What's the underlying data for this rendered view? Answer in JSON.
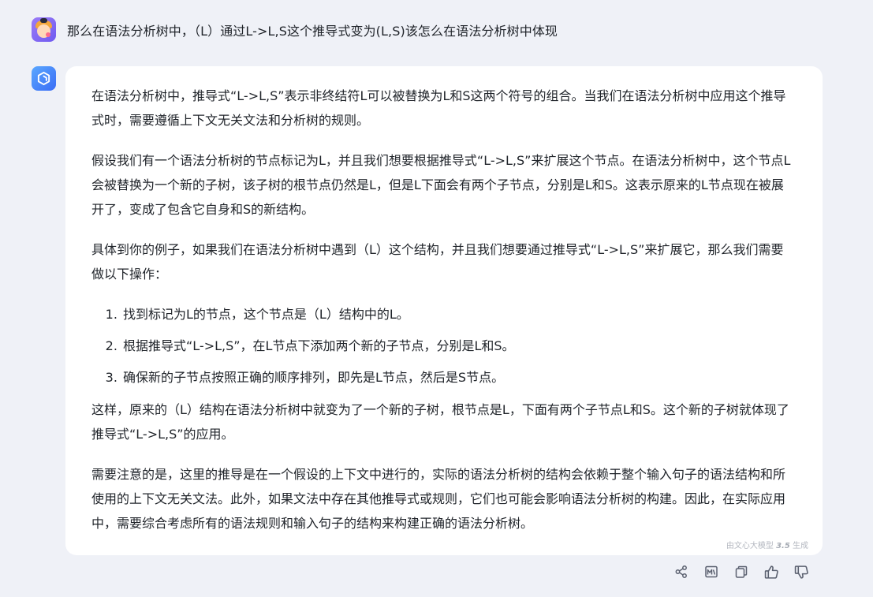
{
  "user": {
    "avatar_icon": "user-avatar-icon",
    "question": "那么在语法分析树中，（L）通过L->L,S这个推导式变为(L,S)该怎么在语法分析树中体现"
  },
  "bot": {
    "avatar_icon": "bot-avatar-icon",
    "paragraphs": [
      "在语法分析树中，推导式“L->L,S”表示非终结符L可以被替换为L和S这两个符号的组合。当我们在语法分析树中应用这个推导式时，需要遵循上下文无关文法和分析树的规则。",
      "假设我们有一个语法分析树的节点标记为L，并且我们想要根据推导式“L->L,S”来扩展这个节点。在语法分析树中，这个节点L会被替换为一个新的子树，该子树的根节点仍然是L，但是L下面会有两个子节点，分别是L和S。这表示原来的L节点现在被展开了，变成了包含它自身和S的新结构。",
      "具体到你的例子，如果我们在语法分析树中遇到（L）这个结构，并且我们想要通过推导式“L->L,S”来扩展它，那么我们需要做以下操作："
    ],
    "steps": [
      "找到标记为L的节点，这个节点是（L）结构中的L。",
      "根据推导式“L->L,S”，在L节点下添加两个新的子节点，分别是L和S。",
      "确保新的子节点按照正确的顺序排列，即先是L节点，然后是S节点。"
    ],
    "after": [
      "这样，原来的（L）结构在语法分析树中就变为了一个新的子树，根节点是L，下面有两个子节点L和S。这个新的子树就体现了推导式“L->L,S”的应用。",
      "需要注意的是，这里的推导是在一个假设的上下文中进行的，实际的语法分析树的结构会依赖于整个输入句子的语法结构和所使用的上下文无关文法。此外，如果文法中存在其他推导式或规则，它们也可能会影响语法分析树的构建。因此，在实际应用中，需要综合考虑所有的语法规则和输入句子的结构来构建正确的语法分析树。"
    ],
    "watermark_prefix": "由文心大模型",
    "watermark_version": "3.5",
    "watermark_suffix": "生成"
  },
  "actions": [
    {
      "icon": "share-icon"
    },
    {
      "icon": "image-icon"
    },
    {
      "icon": "copy-icon"
    },
    {
      "icon": "thumbs-up-icon"
    },
    {
      "icon": "thumbs-down-icon"
    }
  ],
  "colors": {
    "background": "#eff1f7",
    "card": "#ffffff",
    "text": "#1f2329",
    "icon": "#5b6170"
  }
}
